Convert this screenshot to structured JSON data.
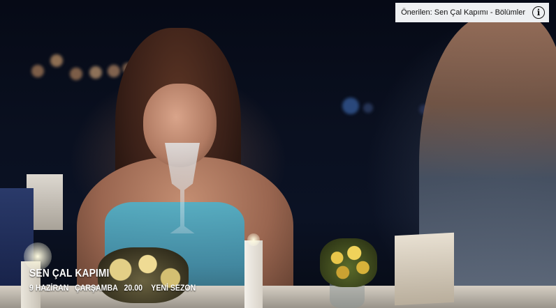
{
  "info_card": {
    "text": "Önerilen: Sen Çal Kapımı - Bölümler",
    "icon": "info-icon",
    "icon_glyph": "i"
  },
  "promo": {
    "title": "SEN ÇAL KAPIMI",
    "date": "9 HAZİRAN",
    "day": "ÇARŞAMBA",
    "time": "20.00",
    "season": "YENİ SEZON"
  }
}
